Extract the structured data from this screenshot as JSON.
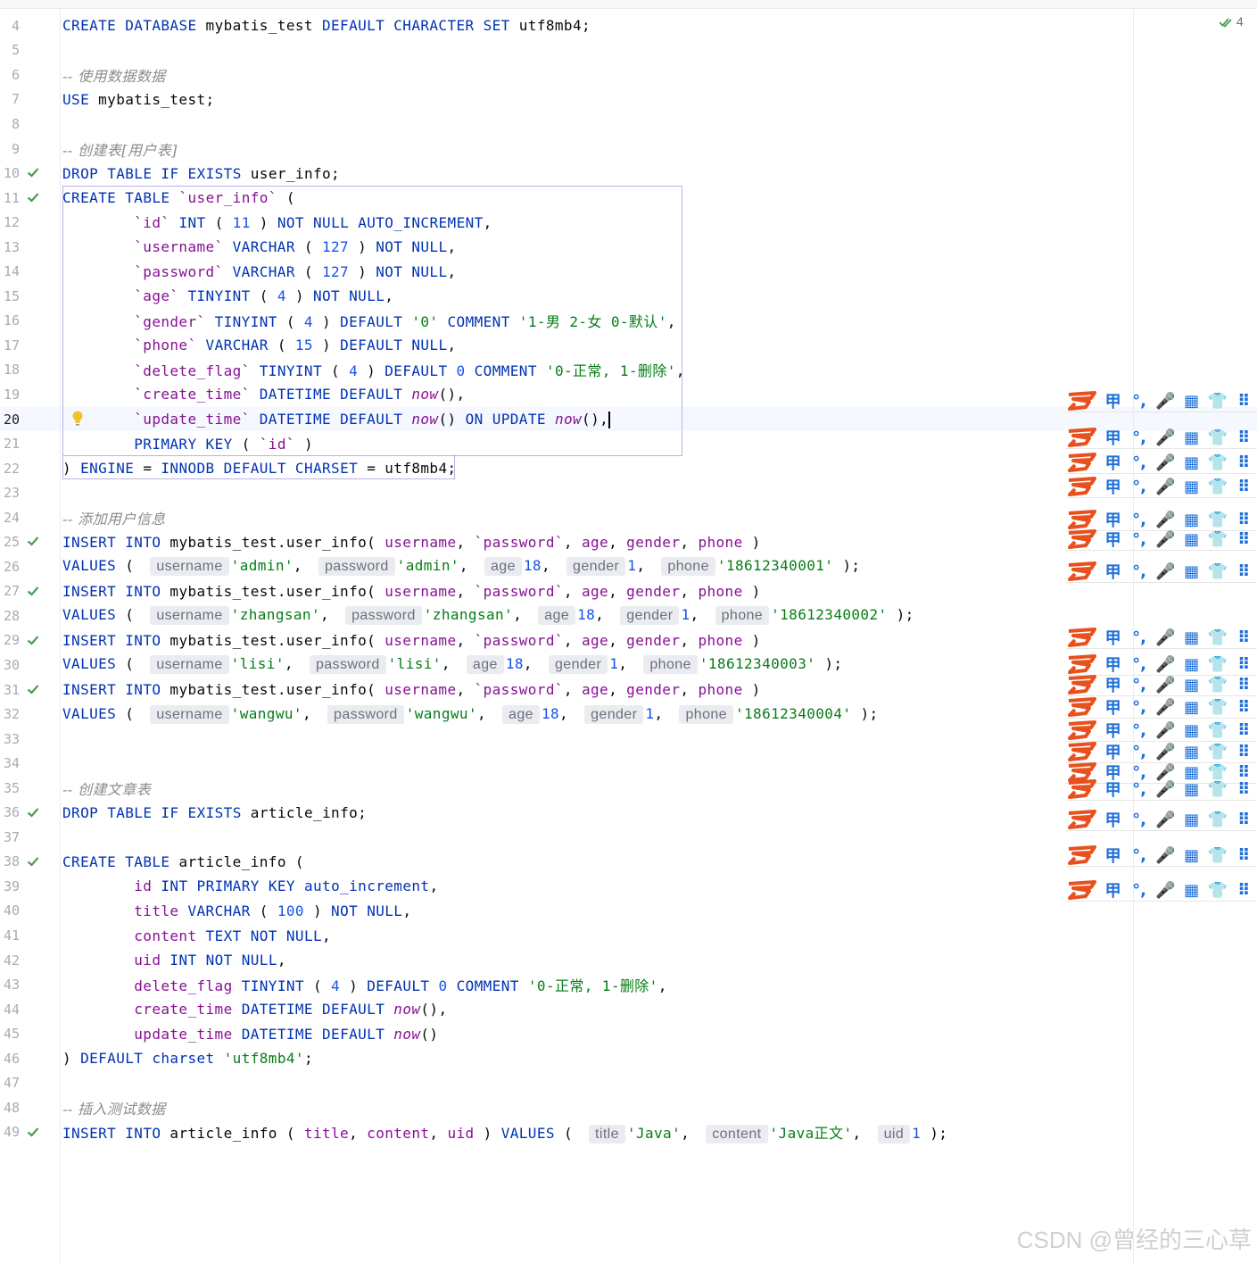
{
  "editor": {
    "inspection_count": "4",
    "current_line": "20"
  },
  "lines": [
    {
      "n": "4",
      "check": false,
      "text": "CREATE DATABASE mybatis_test DEFAULT CHARACTER SET utf8mb4;"
    },
    {
      "n": "5",
      "check": false,
      "text": ""
    },
    {
      "n": "6",
      "check": false,
      "text": "-- 使用数据数据"
    },
    {
      "n": "7",
      "check": false,
      "text": "USE mybatis_test;"
    },
    {
      "n": "8",
      "check": false,
      "text": ""
    },
    {
      "n": "9",
      "check": false,
      "text": "-- 创建表[用户表]"
    },
    {
      "n": "10",
      "check": true,
      "text": "DROP TABLE IF EXISTS user_info;"
    },
    {
      "n": "11",
      "check": true,
      "text": "CREATE TABLE `user_info` ("
    },
    {
      "n": "12",
      "check": false,
      "text": "        `id` INT ( 11 ) NOT NULL AUTO_INCREMENT,"
    },
    {
      "n": "13",
      "check": false,
      "text": "        `username` VARCHAR ( 127 ) NOT NULL,"
    },
    {
      "n": "14",
      "check": false,
      "text": "        `password` VARCHAR ( 127 ) NOT NULL,"
    },
    {
      "n": "15",
      "check": false,
      "text": "        `age` TINYINT ( 4 ) NOT NULL,"
    },
    {
      "n": "16",
      "check": false,
      "text": "        `gender` TINYINT ( 4 ) DEFAULT '0' COMMENT '1-男 2-女 0-默认',"
    },
    {
      "n": "17",
      "check": false,
      "text": "        `phone` VARCHAR ( 15 ) DEFAULT NULL,"
    },
    {
      "n": "18",
      "check": false,
      "text": "        `delete_flag` TINYINT ( 4 ) DEFAULT 0 COMMENT '0-正常, 1-删除',"
    },
    {
      "n": "19",
      "check": false,
      "text": "        `create_time` DATETIME DEFAULT now(),"
    },
    {
      "n": "20",
      "check": false,
      "text": "        `update_time` DATETIME DEFAULT now() ON UPDATE now(),"
    },
    {
      "n": "21",
      "check": false,
      "text": "        PRIMARY KEY ( `id` )"
    },
    {
      "n": "22",
      "check": false,
      "text": ") ENGINE = INNODB DEFAULT CHARSET = utf8mb4;"
    },
    {
      "n": "23",
      "check": false,
      "text": ""
    },
    {
      "n": "24",
      "check": false,
      "text": "-- 添加用户信息"
    },
    {
      "n": "25",
      "check": true,
      "text": "INSERT INTO mybatis_test.user_info( username, `password`, age, gender, phone )"
    },
    {
      "n": "26",
      "check": false,
      "text": "VALUES ( username 'admin', password 'admin', age 18, gender 1, phone '18612340001' );"
    },
    {
      "n": "27",
      "check": true,
      "text": "INSERT INTO mybatis_test.user_info( username, `password`, age, gender, phone )"
    },
    {
      "n": "28",
      "check": false,
      "text": "VALUES ( username 'zhangsan', password 'zhangsan', age 18, gender 1, phone '18612340002' );"
    },
    {
      "n": "29",
      "check": true,
      "text": "INSERT INTO mybatis_test.user_info( username, `password`, age, gender, phone )"
    },
    {
      "n": "30",
      "check": false,
      "text": "VALUES ( username 'lisi', password 'lisi', age 18, gender 1, phone '18612340003' );"
    },
    {
      "n": "31",
      "check": true,
      "text": "INSERT INTO mybatis_test.user_info( username, `password`, age, gender, phone )"
    },
    {
      "n": "32",
      "check": false,
      "text": "VALUES ( username 'wangwu', password 'wangwu', age 18, gender 1, phone '18612340004' );"
    },
    {
      "n": "33",
      "check": false,
      "text": ""
    },
    {
      "n": "34",
      "check": false,
      "text": ""
    },
    {
      "n": "35",
      "check": false,
      "text": "-- 创建文章表"
    },
    {
      "n": "36",
      "check": true,
      "text": "DROP TABLE IF EXISTS article_info;"
    },
    {
      "n": "37",
      "check": false,
      "text": ""
    },
    {
      "n": "38",
      "check": true,
      "text": "CREATE TABLE article_info ("
    },
    {
      "n": "39",
      "check": false,
      "text": "        id INT PRIMARY KEY auto_increment,"
    },
    {
      "n": "40",
      "check": false,
      "text": "        title VARCHAR ( 100 ) NOT NULL,"
    },
    {
      "n": "41",
      "check": false,
      "text": "        content TEXT NOT NULL,"
    },
    {
      "n": "42",
      "check": false,
      "text": "        uid INT NOT NULL,"
    },
    {
      "n": "43",
      "check": false,
      "text": "        delete_flag TINYINT ( 4 ) DEFAULT 0 COMMENT '0-正常, 1-删除',"
    },
    {
      "n": "44",
      "check": false,
      "text": "        create_time DATETIME DEFAULT now(),"
    },
    {
      "n": "45",
      "check": false,
      "text": "        update_time DATETIME DEFAULT now()"
    },
    {
      "n": "46",
      "check": false,
      "text": ") DEFAULT charset 'utf8mb4';"
    },
    {
      "n": "47",
      "check": false,
      "text": ""
    },
    {
      "n": "48",
      "check": false,
      "text": "-- 插入测试数据"
    },
    {
      "n": "49",
      "check": true,
      "text": "INSERT INTO article_info ( title, content, uid ) VALUES ( title 'Java', content 'Java正文', uid 1 );"
    }
  ],
  "ime_toolbar": {
    "glyphs": [
      "甲",
      "°,",
      "🎤",
      "▦",
      "👕",
      "⠿"
    ]
  },
  "colors": {
    "keyword": "#0033b3",
    "string": "#067d17",
    "number": "#1750eb",
    "comment": "#8c8c8c",
    "function": "#871094",
    "check": "#499c54",
    "ime_blue": "#1e6fd9",
    "ime_red": "#e8501e"
  },
  "watermark": "CSDN @曾经的三心草"
}
